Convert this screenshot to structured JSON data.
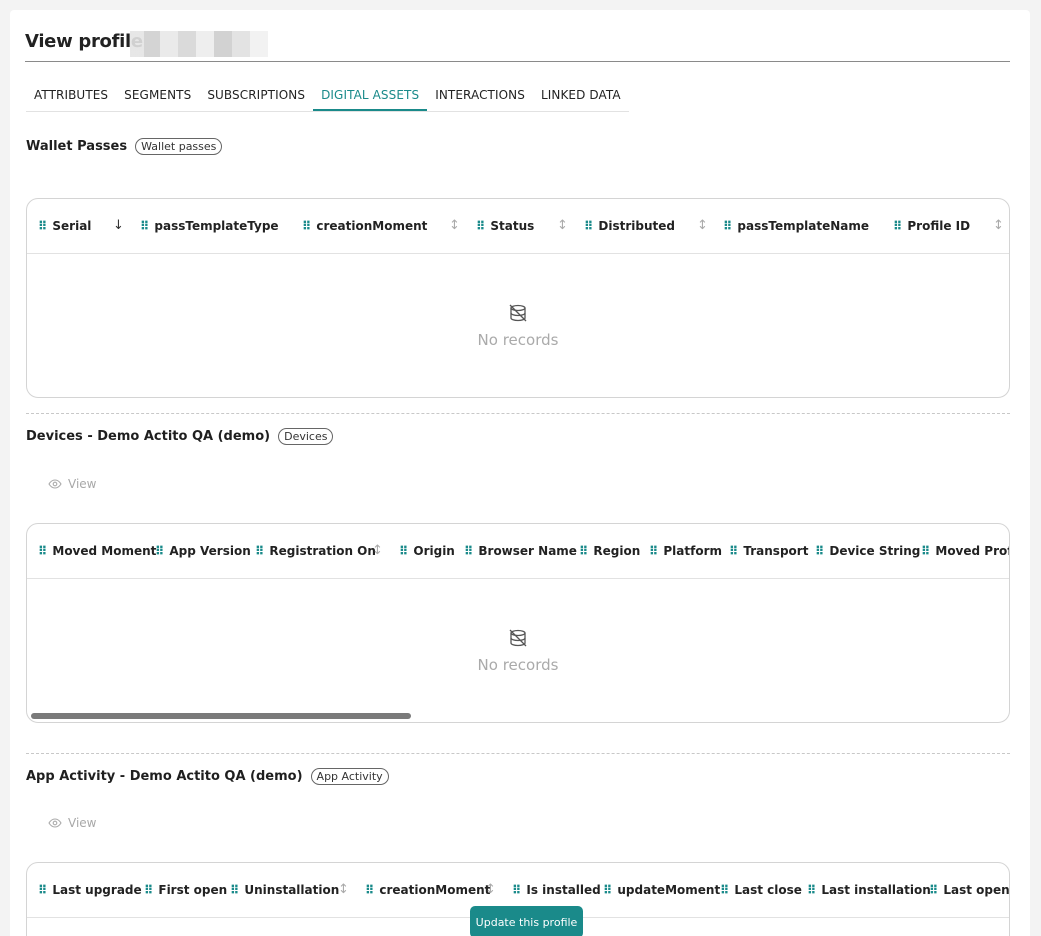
{
  "page": {
    "title": "View profile"
  },
  "tabs": [
    "ATTRIBUTES",
    "SEGMENTS",
    "SUBSCRIPTIONS",
    "DIGITAL ASSETS",
    "INTERACTIONS",
    "LINKED DATA"
  ],
  "active_tab": "DIGITAL ASSETS",
  "wallet": {
    "title": "Wallet Passes",
    "badge": "Wallet passes",
    "columns": [
      "Serial",
      "passTemplateType",
      "creationMoment",
      "Status",
      "Distributed",
      "passTemplateName",
      "Profile ID"
    ],
    "empty_text": "No records"
  },
  "devices": {
    "title": "Devices - Demo Actito QA (demo)",
    "badge": "Devices",
    "view_label": "View",
    "columns": [
      "Moved Moment",
      "App Version",
      "Registration On",
      "Origin",
      "Browser Name",
      "Region",
      "Platform",
      "Transport",
      "Device String",
      "Moved Profile"
    ],
    "empty_text": "No records"
  },
  "app_activity": {
    "title": "App Activity - Demo Actito QA (demo)",
    "badge": "App Activity",
    "view_label": "View",
    "columns": [
      "Last upgrade",
      "First open",
      "Uninstallation",
      "creationMoment",
      "Is installed",
      "updateMoment",
      "Last close",
      "Last installation",
      "Last open"
    ]
  },
  "update_button": "Update this profile",
  "icons": {
    "grip": "drag-handle-icon",
    "sort": "sort-icon",
    "sort_desc": "sort-desc-icon",
    "eye": "eye-icon",
    "empty": "database-off-icon"
  },
  "colors": {
    "accent": "#1a8a8a"
  }
}
